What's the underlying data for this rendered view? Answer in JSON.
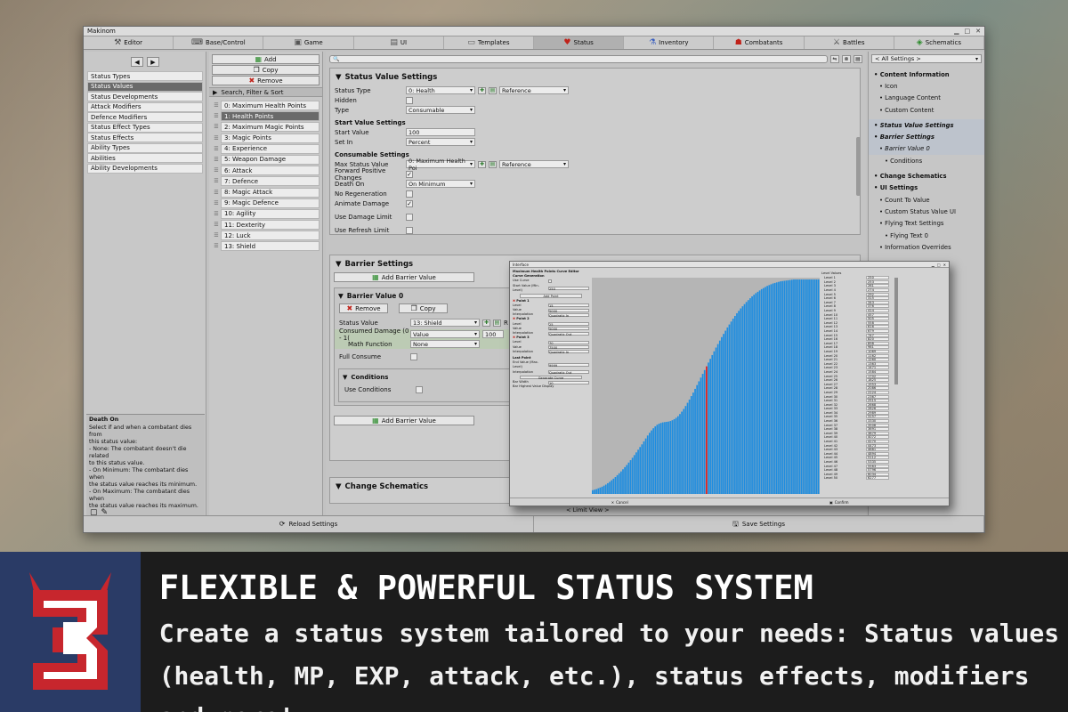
{
  "window_title": "Makinom",
  "tabs": [
    {
      "label": "Editor",
      "icon": "tools-icon",
      "glyph": "⚒",
      "color": "#444444"
    },
    {
      "label": "Base/Control",
      "icon": "gamepad-icon",
      "glyph": "⌨",
      "color": "#444444"
    },
    {
      "label": "Game",
      "icon": "cube-icon",
      "glyph": "▣",
      "color": "#555555"
    },
    {
      "label": "UI",
      "icon": "ui-icon",
      "glyph": "▤",
      "color": "#555555"
    },
    {
      "label": "Templates",
      "icon": "document-icon",
      "glyph": "▭",
      "color": "#555555"
    },
    {
      "label": "Status",
      "icon": "heart-icon",
      "glyph": "♥",
      "color": "#c0221a"
    },
    {
      "label": "Inventory",
      "icon": "potion-icon",
      "glyph": "⚗",
      "color": "#3a5fbf"
    },
    {
      "label": "Combatants",
      "icon": "character-icon",
      "glyph": "☗",
      "color": "#c0221a"
    },
    {
      "label": "Battles",
      "icon": "swords-icon",
      "glyph": "⚔",
      "color": "#444444"
    },
    {
      "label": "Schematics",
      "icon": "schematic-icon",
      "glyph": "◈",
      "color": "#2a8a2a"
    }
  ],
  "active_tab": "Status",
  "sections": [
    "Status Types",
    "Status Values",
    "Status Developments",
    "Attack Modifiers",
    "Defence Modifiers",
    "Status Effect Types",
    "Status Effects",
    "Ability Types",
    "Abilities",
    "Ability Developments"
  ],
  "help": {
    "title": "Death On",
    "lines": [
      "Select if and when a combatant dies from",
      "this status value:",
      "- None: The combatant doesn't die related",
      "to this status value.",
      "- On Minimum: The combatant dies when",
      "the status value reaches its minimum.",
      "- On Maximum: The combatant dies when",
      "the status value reaches its maximum."
    ]
  },
  "list_buttons": {
    "add": "Add",
    "copy": "Copy",
    "remove": "Remove"
  },
  "search_filter_label": "Search, Filter & Sort",
  "status_values": [
    "0: Maximum Health Points",
    "1: Health Points",
    "2: Maximum Magic Points",
    "3: Magic Points",
    "4: Experience",
    "5: Weapon Damage",
    "6: Attack",
    "7: Defence",
    "8: Magic Attack",
    "9: Magic Defence",
    "10: Agility",
    "11: Dexterity",
    "12: Luck",
    "13: Shield"
  ],
  "selected_status_value": "1: Health Points",
  "svs": {
    "title": "Status Value Settings",
    "status_type_label": "Status Type",
    "status_type_value": "0: Health",
    "status_type_ref": "Reference",
    "hidden_label": "Hidden",
    "type_label": "Type",
    "type_value": "Consumable",
    "start_header": "Start Value Settings",
    "start_value_label": "Start Value",
    "start_value": "100",
    "set_in_label": "Set In",
    "set_in_value": "Percent",
    "consumable_header": "Consumable Settings",
    "max_sv_label": "Max Status Value",
    "max_sv_value": "0: Maximum Health Poi",
    "max_sv_ref": "Reference",
    "fpc_label": "Forward Positive Changes",
    "death_on_label": "Death On",
    "death_on_value": "On Minimum",
    "no_regen_label": "No Regeneration",
    "animate_label": "Animate Damage",
    "dmg_limit_label": "Use Damage Limit",
    "refresh_limit_label": "Use Refresh Limit"
  },
  "barrier": {
    "title": "Barrier Settings",
    "add_label": "Add Barrier Value",
    "bv_title": "Barrier Value 0",
    "remove_label": "Remove",
    "copy_label": "Copy",
    "status_value_label": "Status Value",
    "status_value": "13: Shield",
    "consumed_label": "Consumed Damage (0 - 1(",
    "consumed_type": "Value",
    "consumed_value": "100",
    "math_label": "Math Function",
    "math_value": "None",
    "full_consume_label": "Full Consume",
    "conditions_title": "Conditions",
    "use_conditions_label": "Use Conditions",
    "truncated_r": "R"
  },
  "change_schematics_title": "Change Schematics",
  "limit_view": "< Limit View >",
  "right": {
    "dropdown": "< All Settings >",
    "items": [
      {
        "label": "• Content Information",
        "cls": "l1"
      },
      {
        "label": "• Icon",
        "cls": "l2"
      },
      {
        "label": "• Language Content",
        "cls": "l2"
      },
      {
        "label": "• Custom Content",
        "cls": "l2"
      },
      {
        "label": "• Status Value Settings",
        "cls": "l1 it hl"
      },
      {
        "label": "• Barrier Settings",
        "cls": "l1 it hl"
      },
      {
        "label": "• Barrier Value 0",
        "cls": "l2 it hl"
      },
      {
        "label": "• Conditions",
        "cls": "l3"
      },
      {
        "label": "• Change Schematics",
        "cls": "l1"
      },
      {
        "label": "• UI Settings",
        "cls": "l1"
      },
      {
        "label": "• Count To Value",
        "cls": "l2"
      },
      {
        "label": "• Custom Status Value UI",
        "cls": "l2"
      },
      {
        "label": "• Flying Text Settings",
        "cls": "l2"
      },
      {
        "label": "• Flying Text 0",
        "cls": "l3"
      },
      {
        "label": "• Information Overrides",
        "cls": "l2"
      }
    ]
  },
  "footer": {
    "reload": "Reload Settings",
    "save": "Save Settings"
  },
  "curve": {
    "window_title": "Interface",
    "heading": "Maximum Health Points Curve Editor",
    "curve_gen": "Curve Generation",
    "use_curve": "Use Curve",
    "start_value_label": "Start Value (Min. Level)",
    "start_value": "250",
    "add_point": "Add Point",
    "points": [
      {
        "name": "Point 1",
        "level": "15",
        "value": "5000",
        "interp": "Quadratic In"
      },
      {
        "name": "Point 2",
        "level": "25",
        "value": "5000",
        "interp": "Quadratic Out"
      },
      {
        "name": "Point 3",
        "level": "70",
        "value": "7500",
        "interp": "Quadratic In"
      }
    ],
    "level_label": "Level",
    "value_label": "Value",
    "interp_label": "Interpolation",
    "last_point": "Last Point",
    "end_value_label": "End Value (Max. Level)",
    "end_value": "9999",
    "end_interp": "Quadratic Out",
    "generate": "Generate Curve",
    "bar_width_label": "Bar Width",
    "bar_width": "10",
    "bar_highest_label": "Bar Highest Value Display",
    "cancel": "Cancel",
    "confirm": "Confirm",
    "level_values_title": "Level Values",
    "levels": [
      [
        "Level 1",
        "250"
      ],
      [
        "Level 2",
        "253"
      ],
      [
        "Level 3",
        "261"
      ],
      [
        "Level 4",
        "274"
      ],
      [
        "Level 5",
        "292"
      ],
      [
        "Level 6",
        "315"
      ],
      [
        "Level 7",
        "343"
      ],
      [
        "Level 8",
        "376"
      ],
      [
        "Level 9",
        "414"
      ],
      [
        "Level 10",
        "457"
      ],
      [
        "Level 11",
        "505"
      ],
      [
        "Level 12",
        "558"
      ],
      [
        "Level 13",
        "616"
      ],
      [
        "Level 14",
        "679"
      ],
      [
        "Level 15",
        "747"
      ],
      [
        "Level 16",
        "820"
      ],
      [
        "Level 17",
        "898"
      ],
      [
        "Level 18",
        "981"
      ],
      [
        "Level 19",
        "1069"
      ],
      [
        "Level 20",
        "1162"
      ],
      [
        "Level 21",
        "1260"
      ],
      [
        "Level 22",
        "1363"
      ],
      [
        "Level 23",
        "1471"
      ],
      [
        "Level 24",
        "1584"
      ],
      [
        "Level 25",
        "1702"
      ],
      [
        "Level 26",
        "1825"
      ],
      [
        "Level 27",
        "1953"
      ],
      [
        "Level 28",
        "2086"
      ],
      [
        "Level 29",
        "2224"
      ],
      [
        "Level 30",
        "2367"
      ],
      [
        "Level 31",
        "2515"
      ],
      [
        "Level 32",
        "2668"
      ],
      [
        "Level 33",
        "2826"
      ],
      [
        "Level 34",
        "2989"
      ],
      [
        "Level 35",
        "3157"
      ],
      [
        "Level 36",
        "3330"
      ],
      [
        "Level 37",
        "3508"
      ],
      [
        "Level 38",
        "3691"
      ],
      [
        "Level 39",
        "3879"
      ],
      [
        "Level 40",
        "4072"
      ],
      [
        "Level 41",
        "4270"
      ],
      [
        "Level 42",
        "4473"
      ],
      [
        "Level 43",
        "4681"
      ],
      [
        "Level 44",
        "4894"
      ],
      [
        "Level 45",
        "5112"
      ],
      [
        "Level 46",
        "5335"
      ],
      [
        "Level 47",
        "5563"
      ],
      [
        "Level 48",
        "5796"
      ],
      [
        "Level 49",
        "6034"
      ],
      [
        "Level 50",
        "6277"
      ]
    ],
    "bar_color": "#1e8de0",
    "highlight_color": "#e02020",
    "highlight_index": 60,
    "bars": [
      14,
      16,
      18,
      21,
      24,
      27,
      31,
      35,
      40,
      45,
      51,
      57,
      63,
      70,
      77,
      84,
      92,
      100,
      108,
      117,
      126,
      135,
      145,
      155,
      165,
      175,
      185,
      196,
      207,
      218,
      228,
      237,
      245,
      252,
      258,
      262,
      265,
      267,
      268,
      269,
      270,
      272,
      275,
      279,
      284,
      290,
      298,
      307,
      317,
      328,
      340,
      352,
      365,
      378,
      392,
      406,
      420,
      434,
      448,
      462,
      476,
      490,
      504,
      518,
      532,
      546,
      559,
      572,
      585,
      597,
      609,
      621,
      632,
      643,
      654,
      664,
      674,
      683,
      692,
      700,
      708,
      716,
      723,
      730,
      737,
      743,
      749,
      754,
      759,
      764,
      768,
      772,
      776,
      779,
      782,
      785,
      787,
      789,
      791,
      793,
      794,
      795,
      796,
      797,
      798,
      799,
      800,
      800,
      800,
      800,
      800,
      800,
      800,
      800,
      800,
      800,
      800,
      800,
      800,
      800
    ]
  },
  "banner": {
    "number": "3",
    "headline": "FLEXIBLE & POWERFUL STATUS SYSTEM",
    "line1": "Create a status system tailored to your needs: Status values",
    "line2": "(health, MP, EXP, attack, etc.), status effects, modifiers and more!",
    "badge_bg": "#2a3b66",
    "badge_red": "#c7262d"
  }
}
